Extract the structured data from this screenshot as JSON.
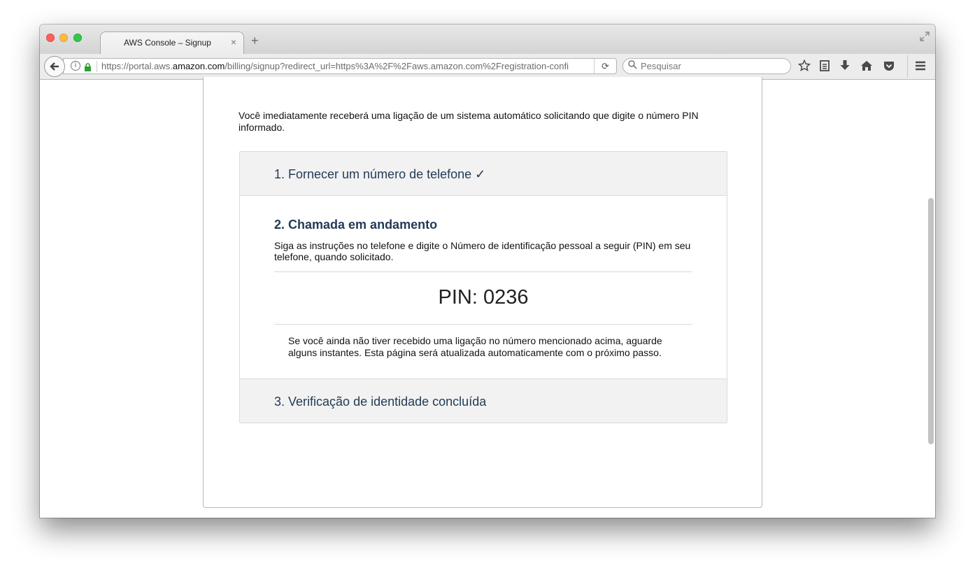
{
  "browser": {
    "tab_title": "AWS Console – Signup",
    "tab_close": "×",
    "new_tab": "+",
    "url_prefix": "https://portal.aws.",
    "url_domain": "amazon.com",
    "url_rest": "/billing/signup?redirect_url=https%3A%2F%2Faws.amazon.com%2Fregistration-confi",
    "search_placeholder": "Pesquisar"
  },
  "page": {
    "intro": "Você imediatamente receberá uma ligação de um sistema automático solicitando que digite o número PIN informado.",
    "step1_title": "1. Fornecer um número de telefone ✓",
    "step2_title": "2. Chamada em andamento",
    "step2_desc": "Siga as instruções no telefone e digite o Número de identificação pessoal a seguir (PIN) em seu telefone, quando solicitado.",
    "pin": "PIN: 0236",
    "note": "Se você ainda não tiver recebido uma ligação no número mencionado acima, aguarde alguns instantes. Esta página será atualizada automaticamente com o próximo passo.",
    "step3_title": "3. Verificação de identidade concluída"
  },
  "icons": [
    "back-arrow-icon",
    "info-icon",
    "lock-icon",
    "reload-icon",
    "search-icon",
    "bookmark-star-icon",
    "reading-list-icon",
    "download-icon",
    "home-icon",
    "pocket-icon",
    "menu-icon",
    "fullscreen-icon"
  ],
  "colors": {
    "heading": "#233b57",
    "step_header_bg": "#f2f2f2",
    "lock": "#2f9e2f"
  }
}
